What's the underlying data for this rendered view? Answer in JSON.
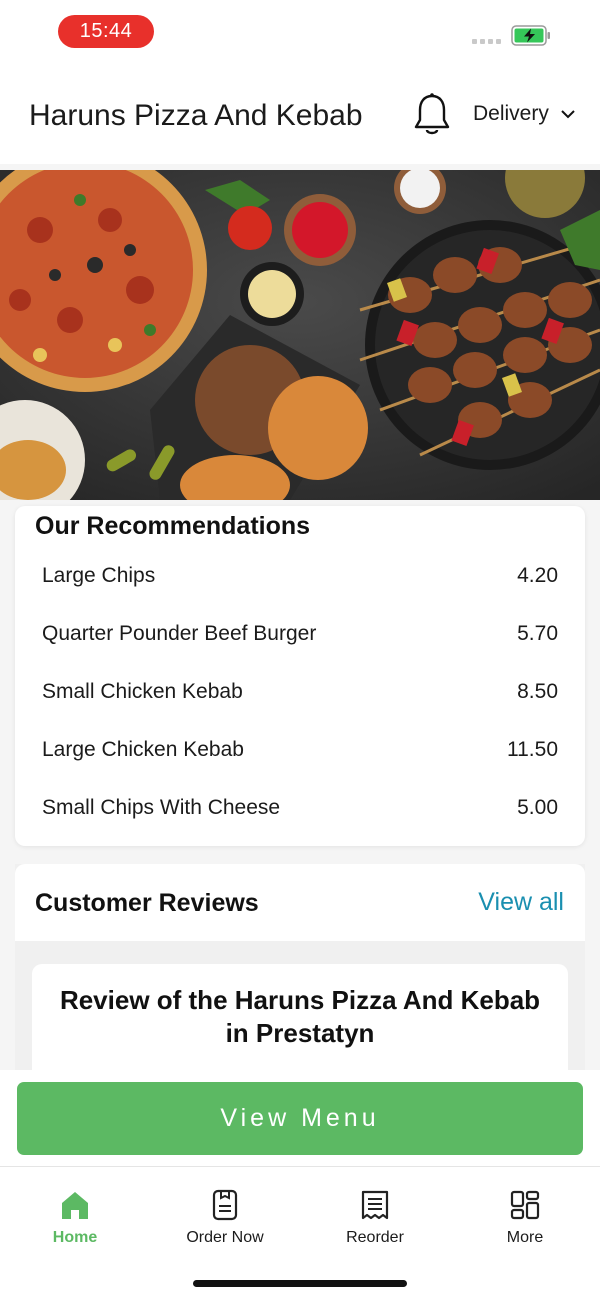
{
  "status_bar": {
    "time": "15:44",
    "battery_color": "#35c759",
    "time_pill_color": "#e8302b"
  },
  "header": {
    "store_name": "Haruns Pizza And Kebab",
    "bell_icon": "bell-icon",
    "delivery_mode": "Delivery",
    "chevron_icon": "chevron-down-icon"
  },
  "hero": {
    "image_name": "food-hero-image"
  },
  "recommendations": {
    "title": "Our Recommendations",
    "items": [
      {
        "name": "Large Chips",
        "price": "4.20"
      },
      {
        "name": "Quarter Pounder Beef Burger",
        "price": "5.70"
      },
      {
        "name": "Small Chicken Kebab",
        "price": "8.50"
      },
      {
        "name": "Large Chicken Kebab",
        "price": "11.50"
      },
      {
        "name": "Small Chips With Cheese",
        "price": "5.00"
      }
    ]
  },
  "reviews": {
    "title": "Customer Reviews",
    "view_all_label": "View all",
    "link_color": "#1a8fb0",
    "review_heading": "Review of the Haruns Pizza And Kebab in Prestatyn"
  },
  "cta": {
    "label": "View Menu",
    "color": "#5cb963"
  },
  "bottom_nav": {
    "items": [
      {
        "label": "Home",
        "icon": "home-icon",
        "active": true
      },
      {
        "label": "Order Now",
        "icon": "order-icon",
        "active": false
      },
      {
        "label": "Reorder",
        "icon": "receipt-icon",
        "active": false
      },
      {
        "label": "More",
        "icon": "grid-icon",
        "active": false
      }
    ]
  }
}
